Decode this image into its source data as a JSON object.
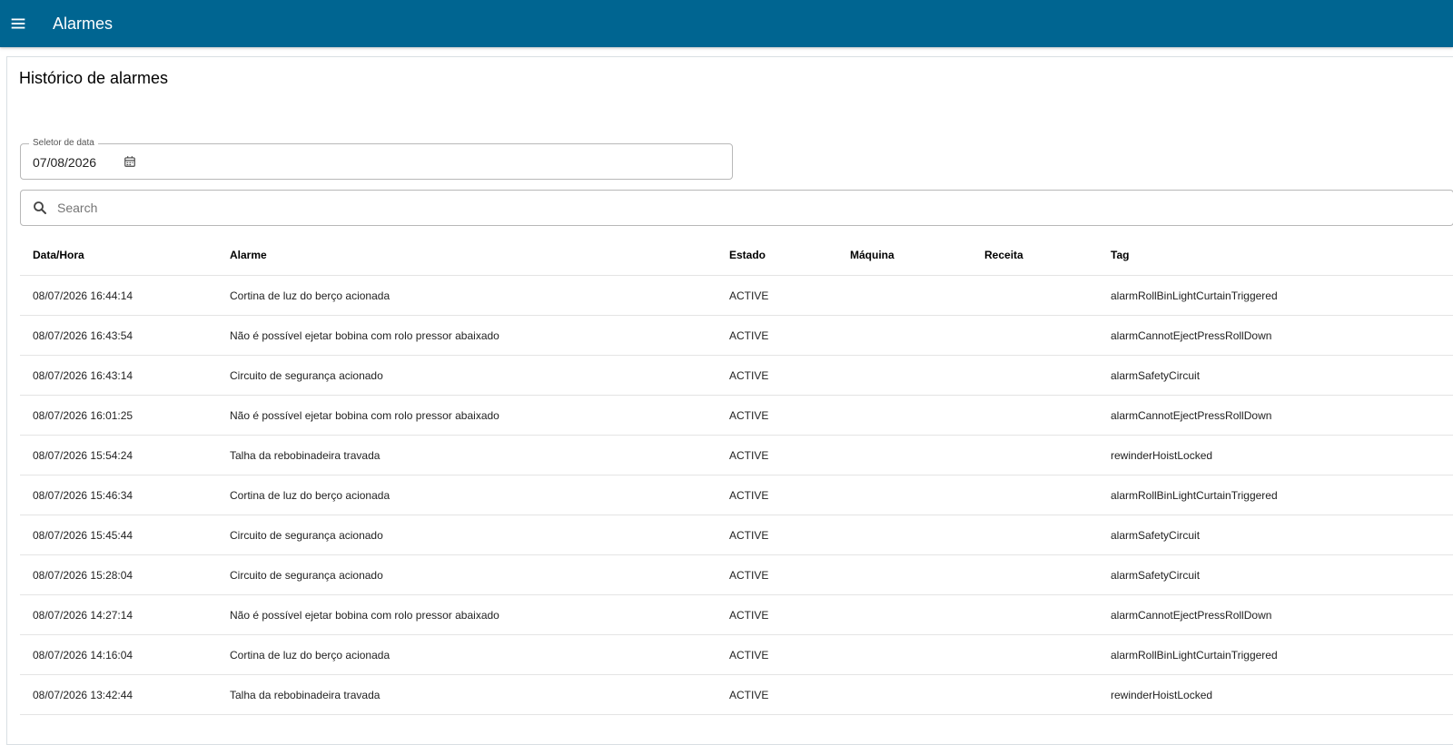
{
  "appbar": {
    "title": "Alarmes",
    "menu_icon": "menu-icon"
  },
  "card": {
    "title": "Histórico de alarmes"
  },
  "date_picker": {
    "label": "Seletor de data",
    "value": "07/08/2026",
    "icon": "calendar-icon"
  },
  "search": {
    "placeholder": "Search",
    "value": "",
    "icon": "search-icon"
  },
  "table": {
    "headers": [
      "Data/Hora",
      "Alarme",
      "Estado",
      "Máquina",
      "Receita",
      "Tag"
    ],
    "rows": [
      [
        "08/07/2026 16:44:14",
        "Cortina de luz do berço acionada",
        "ACTIVE",
        "",
        "",
        "alarmRollBinLightCurtainTriggered"
      ],
      [
        "08/07/2026 16:43:54",
        "Não é possível ejetar bobina com rolo pressor abaixado",
        "ACTIVE",
        "",
        "",
        "alarmCannotEjectPressRollDown"
      ],
      [
        "08/07/2026 16:43:14",
        "Circuito de segurança acionado",
        "ACTIVE",
        "",
        "",
        "alarmSafetyCircuit"
      ],
      [
        "08/07/2026 16:01:25",
        "Não é possível ejetar bobina com rolo pressor abaixado",
        "ACTIVE",
        "",
        "",
        "alarmCannotEjectPressRollDown"
      ],
      [
        "08/07/2026 15:54:24",
        "Talha da rebobinadeira travada",
        "ACTIVE",
        "",
        "",
        "rewinderHoistLocked"
      ],
      [
        "08/07/2026 15:46:34",
        "Cortina de luz do berço acionada",
        "ACTIVE",
        "",
        "",
        "alarmRollBinLightCurtainTriggered"
      ],
      [
        "08/07/2026 15:45:44",
        "Circuito de segurança acionado",
        "ACTIVE",
        "",
        "",
        "alarmSafetyCircuit"
      ],
      [
        "08/07/2026 15:28:04",
        "Circuito de segurança acionado",
        "ACTIVE",
        "",
        "",
        "alarmSafetyCircuit"
      ],
      [
        "08/07/2026 14:27:14",
        "Não é possível ejetar bobina com rolo pressor abaixado",
        "ACTIVE",
        "",
        "",
        "alarmCannotEjectPressRollDown"
      ],
      [
        "08/07/2026 14:16:04",
        "Cortina de luz do berço acionada",
        "ACTIVE",
        "",
        "",
        "alarmRollBinLightCurtainTriggered"
      ],
      [
        "08/07/2026 13:42:44",
        "Talha da rebobinadeira travada",
        "ACTIVE",
        "",
        "",
        "rewinderHoistLocked"
      ]
    ]
  },
  "colors": {
    "appbar": "#006591",
    "border": "#b8b8b8"
  }
}
